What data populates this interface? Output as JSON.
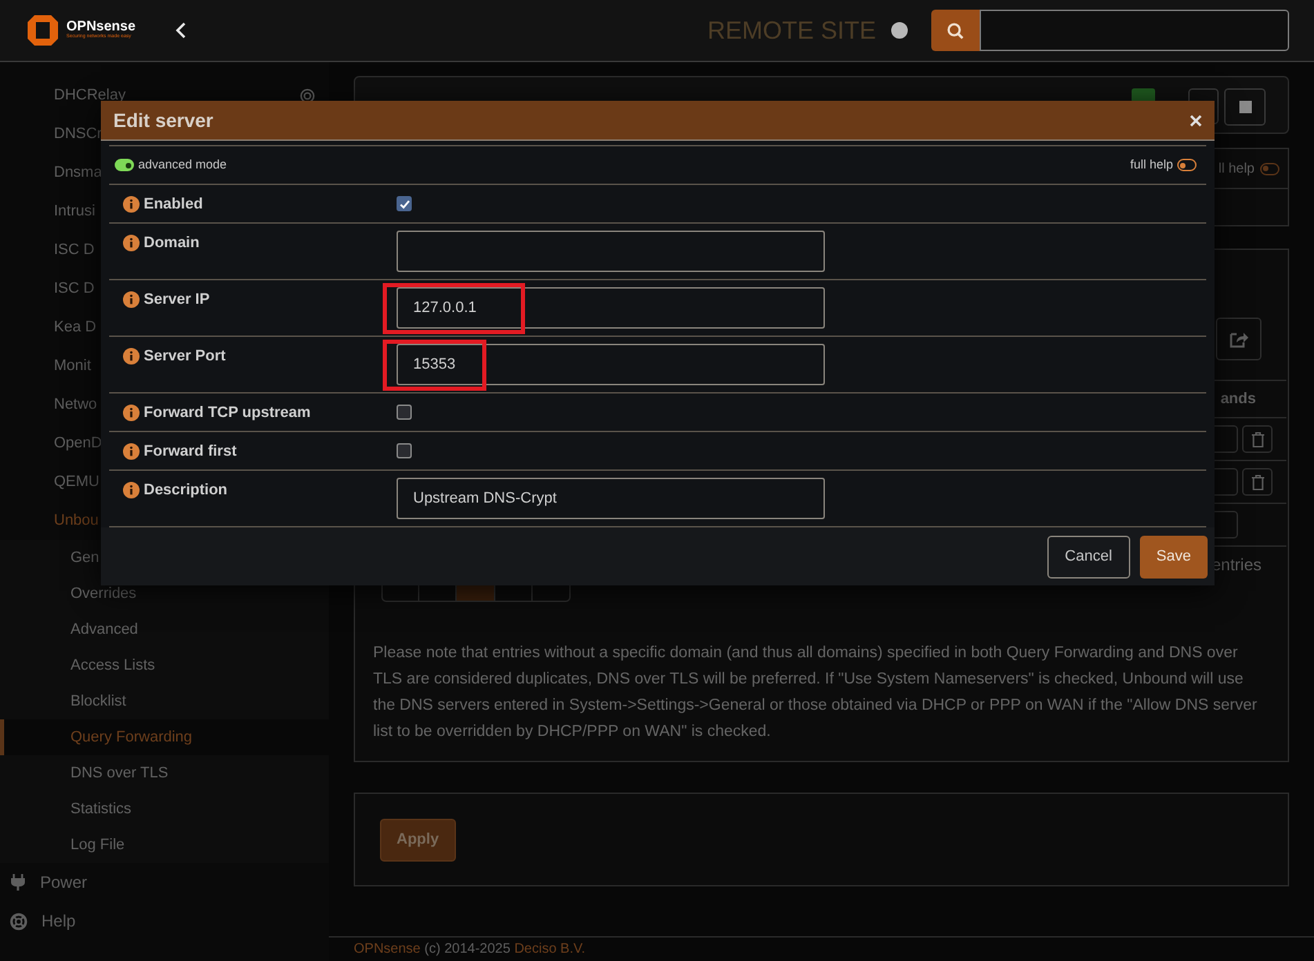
{
  "header": {
    "logo": {
      "name": "OPNsense",
      "tagline": "Securing networks made easy"
    },
    "site": "REMOTE SITE"
  },
  "sidebar": {
    "items": [
      {
        "label": "DHCRelay",
        "selected": false
      },
      {
        "label": "DNSCr",
        "selected": false
      },
      {
        "label": "Dnsma",
        "selected": false
      },
      {
        "label": "Intrusi",
        "selected": false
      },
      {
        "label": "ISC D",
        "selected": false
      },
      {
        "label": "ISC D",
        "selected": false
      },
      {
        "label": "Kea D",
        "selected": false
      },
      {
        "label": "Monit",
        "selected": false
      },
      {
        "label": "Netwo",
        "selected": false
      },
      {
        "label": "OpenD",
        "selected": false
      },
      {
        "label": "QEMU",
        "selected": false
      },
      {
        "label": "Unbou",
        "selected": true,
        "children": [
          {
            "label": "Gen",
            "selected": false
          },
          {
            "label": "Overrides",
            "selected": false
          },
          {
            "label": "Advanced",
            "selected": false
          },
          {
            "label": "Access Lists",
            "selected": false
          },
          {
            "label": "Blocklist",
            "selected": false
          },
          {
            "label": "Query Forwarding",
            "selected": true
          },
          {
            "label": "DNS over TLS",
            "selected": false
          },
          {
            "label": "Statistics",
            "selected": false
          },
          {
            "label": "Log File",
            "selected": false
          }
        ]
      }
    ],
    "sections": [
      {
        "label": "Power"
      },
      {
        "label": "Help"
      }
    ]
  },
  "page": {
    "help_toggle": {
      "label": "ll help",
      "on": false
    },
    "table": {
      "header": "ands"
    },
    "entries": "entries",
    "note": "Please note that entries without a specific domain (and thus all domains) specified in both Query Forwarding and DNS over TLS are considered duplicates, DNS over TLS will be preferred. If \"Use System Nameservers\" is checked, Unbound will use the DNS servers entered in System->Settings->General or those obtained via DHCP or PPP on WAN if the \"Allow DNS server list to be overridden by DHCP/PPP on WAN\" is checked.",
    "apply": "Apply"
  },
  "footer": {
    "brand": "OPNsense",
    "copyright": "(c) 2014-2025",
    "company": "Deciso B.V."
  },
  "dialog": {
    "title": "Edit server",
    "advanced_mode": {
      "label": "advanced mode",
      "on": true
    },
    "full_help": {
      "label": "full help",
      "on": false
    },
    "fields": [
      {
        "kind": "checkbox",
        "label": "Enabled",
        "checked": true
      },
      {
        "kind": "text",
        "label": "Domain",
        "highlighted": false
      },
      {
        "kind": "text",
        "label": "Server IP",
        "value": "127.0.0.1",
        "highlighted": true
      },
      {
        "kind": "text",
        "label": "Server Port",
        "value": "15353",
        "highlighted": true
      },
      {
        "kind": "checkbox",
        "label": "Forward TCP upstream",
        "checked": false
      },
      {
        "kind": "checkbox",
        "label": "Forward first",
        "checked": false
      },
      {
        "kind": "text",
        "label": "Description",
        "value": "Upstream DNS-Crypt",
        "highlighted": false
      }
    ],
    "buttons": {
      "cancel": "Cancel",
      "save": "Save"
    }
  }
}
